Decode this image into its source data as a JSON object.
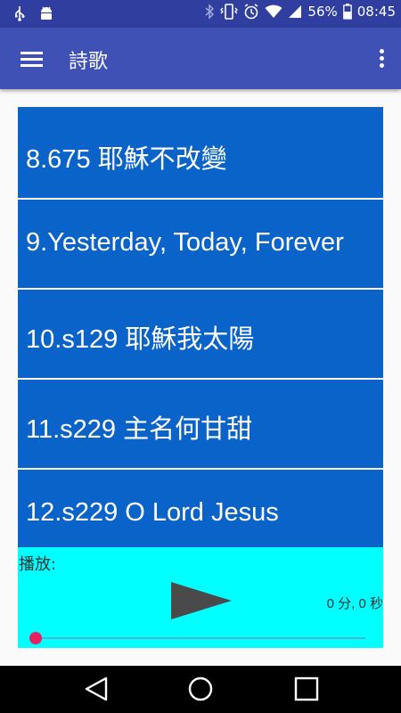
{
  "status_bar": {
    "battery": "56%",
    "time": "08:45",
    "left_icons": [
      "usb-icon",
      "android-icon"
    ],
    "right_icons": [
      "bluetooth-icon",
      "vibrate-icon",
      "alarm-icon",
      "wifi-icon",
      "signal-icon",
      "battery-icon"
    ]
  },
  "app_bar": {
    "title": "詩歌",
    "menu_icon": "hamburger-menu-icon",
    "overflow_icon": "more-vertical-icon",
    "color": "#3f51b5"
  },
  "song_list": {
    "item_color": "#0a63c9",
    "items": [
      {
        "label": "8.675 耶穌不改變"
      },
      {
        "label": "9.Yesterday, Today, Forever"
      },
      {
        "label": "10.s129 耶穌我太陽"
      },
      {
        "label": "11.s229 主名何甘甜"
      },
      {
        "label": "12.s229 O Lord Jesus"
      }
    ]
  },
  "player": {
    "label": "播放:",
    "time": "0 分, 0 秒",
    "progress": 0,
    "background": "#00ffff",
    "play_icon": "play-icon"
  },
  "nav_bar": {
    "buttons": [
      "back-triangle-icon",
      "home-circle-icon",
      "recents-square-icon"
    ]
  }
}
